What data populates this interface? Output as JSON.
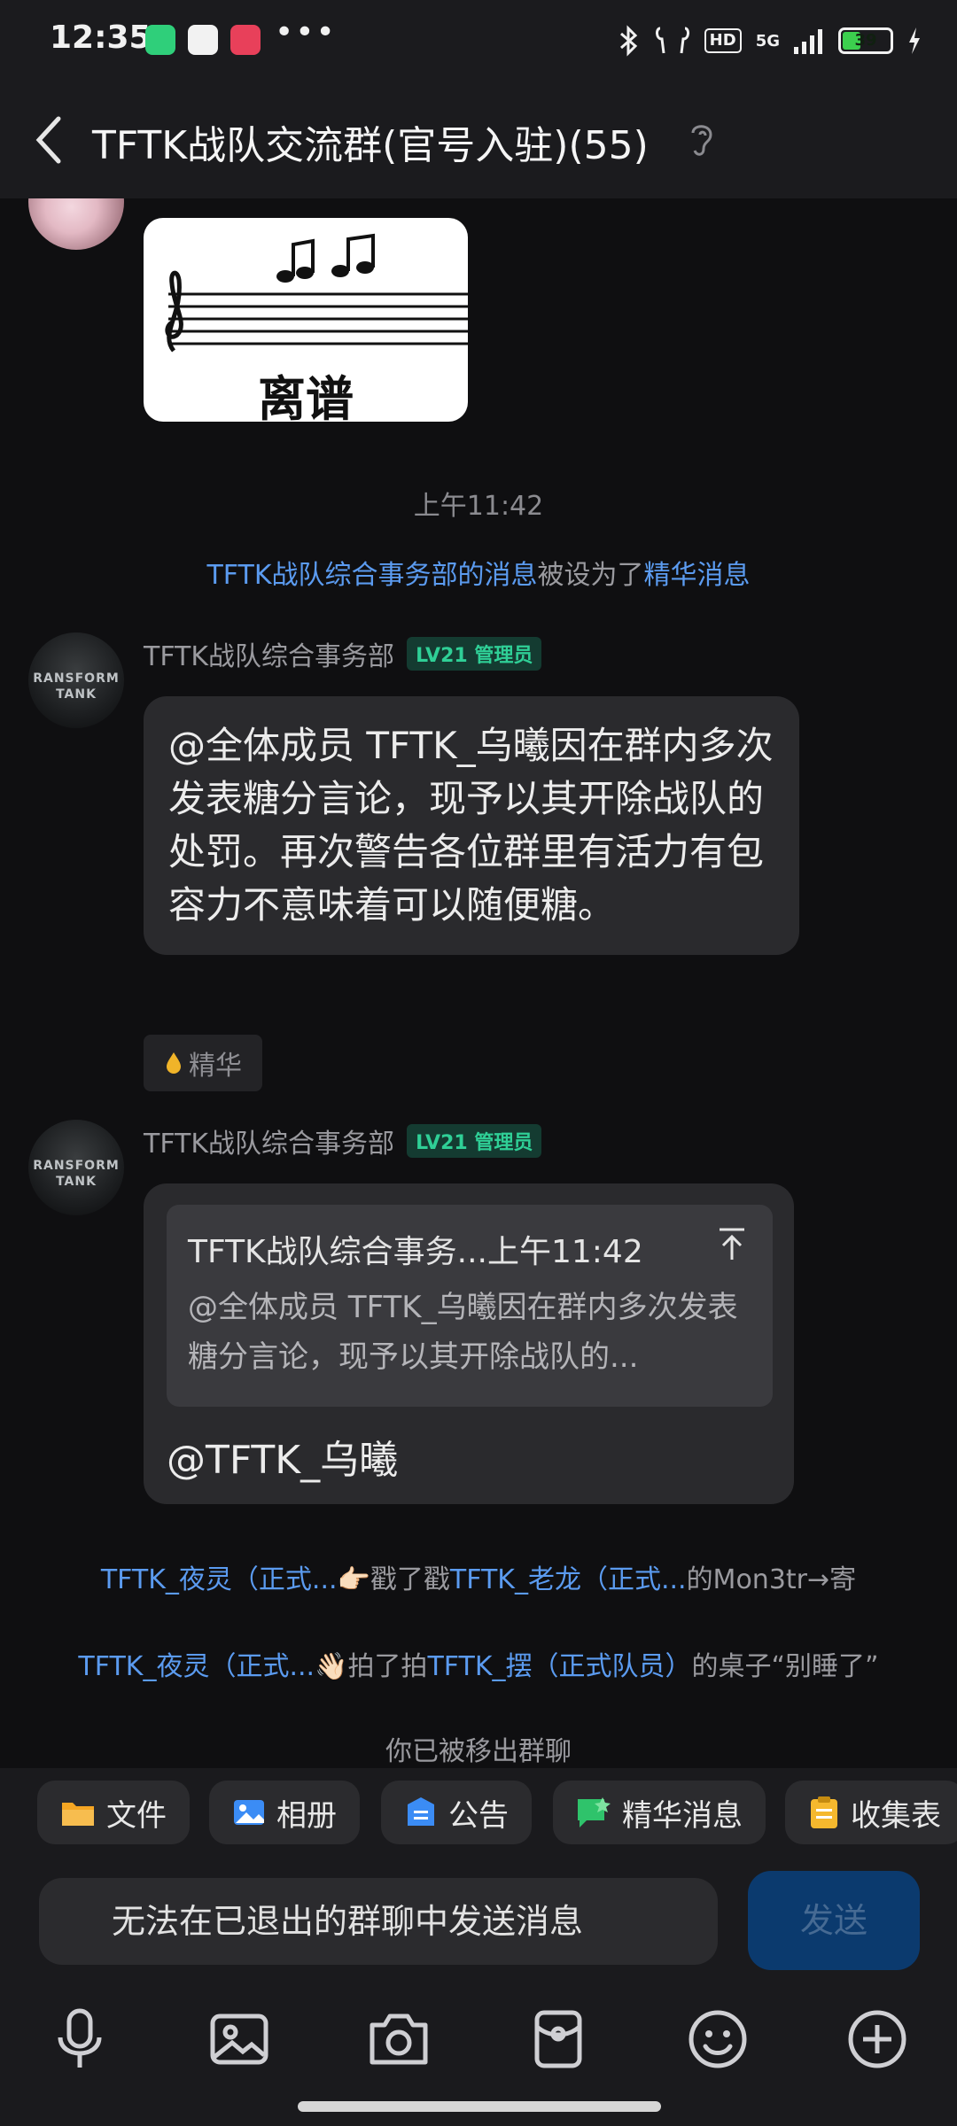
{
  "status_bar": {
    "time": "12:35",
    "more": "•••",
    "hd": "HD",
    "network": "5G",
    "battery": "39"
  },
  "header": {
    "title": "TFTK战队交流群(官号入驻)(55)"
  },
  "chat": {
    "time_separator": "上午11:42",
    "essence_notice": {
      "sender_link": "TFTK战队综合事务部的消息",
      "middle": "被设为了",
      "target_link": "精华消息"
    },
    "messages": [
      {
        "sender": "TFTK战队综合事务部",
        "badge": "LV21 管理员",
        "text": "@全体成员 TFTK_乌曦因在群内多次发表糖分言论，现予以其开除战队的处罚。再次警告各位群里有活力有包容力不意味着可以随便糖。",
        "essence_label": "精华"
      },
      {
        "sender": "TFTK战队综合事务部",
        "badge": "LV21 管理员",
        "quote_header": "TFTK战队综合事务...上午11:42",
        "quote_text": "@全体成员 TFTK_乌曦因在群内多次发表糖分言论，现予以其开除战队的...",
        "reply_text": "@TFTK_乌曦"
      }
    ],
    "poke_1": {
      "actor": "TFTK_夜灵（正式...",
      "emoji": "👉🏻",
      "action": "戳了戳",
      "target": "TFTK_老龙（正式...",
      "suffix": "的Mon3tr→寄"
    },
    "poke_2": {
      "actor": "TFTK_夜灵（正式...",
      "emoji": "👋🏻",
      "action": "拍了拍",
      "target": "TFTK_摆（正式队员）",
      "suffix": "的桌子“别睡了”"
    },
    "removed_notice": "你已被移出群聊",
    "sticker_label": "离谱",
    "avatar_text_1": "RANSFORM",
    "avatar_text_2": "TANK"
  },
  "shortcuts": [
    "文件",
    "相册",
    "公告",
    "精华消息",
    "收集表"
  ],
  "input": {
    "placeholder": "无法在已退出的群聊中发送消息",
    "send_label": "发送"
  },
  "toolbar_icons": [
    "microphone-icon",
    "image-icon",
    "camera-icon",
    "red-packet-icon",
    "emoji-icon",
    "plus-icon"
  ],
  "colors": {
    "link": "#5b9bf0",
    "badge_text": "#2fcf96",
    "send_button": "#0b3a6e",
    "background": "#0f0f11"
  }
}
